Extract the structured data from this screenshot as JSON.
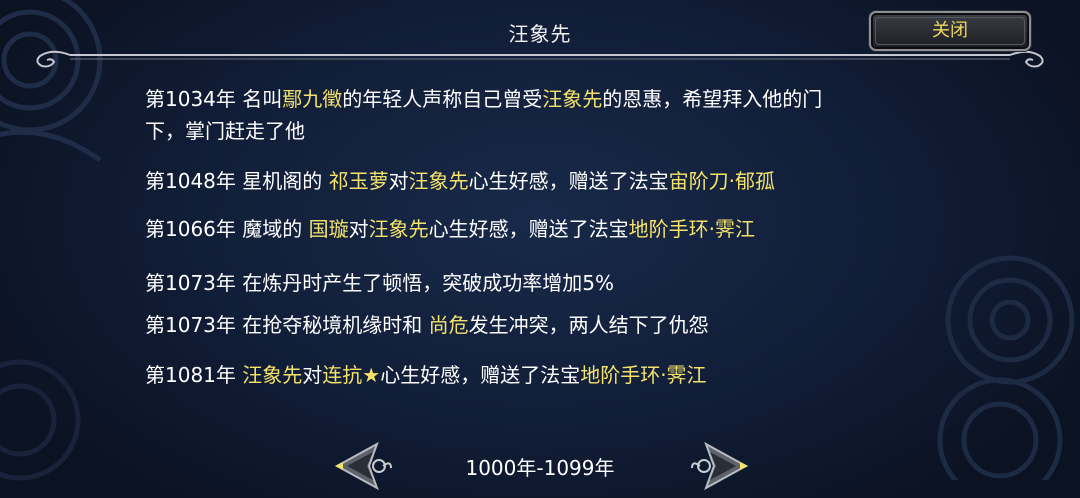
{
  "header": {
    "title": "汪象先",
    "close_label": "关闭"
  },
  "events": [
    {
      "year": "第1034年",
      "parts": [
        {
          "t": " 名叫",
          "hl": false
        },
        {
          "t": "鄢九徵",
          "hl": true
        },
        {
          "t": "的年轻人声称自己曾受",
          "hl": false
        },
        {
          "t": "汪象先",
          "hl": true
        },
        {
          "t": "的恩惠，希望拜入他的门",
          "hl": false
        }
      ],
      "continuation": "下，掌门赶走了他"
    },
    {
      "year": "第1048年",
      "parts": [
        {
          "t": " 星机阁的 ",
          "hl": false
        },
        {
          "t": "祁玉萝",
          "hl": true
        },
        {
          "t": "对",
          "hl": false
        },
        {
          "t": "汪象先",
          "hl": true
        },
        {
          "t": "心生好感，赠送了法宝",
          "hl": false
        },
        {
          "t": "宙阶刀·郁孤",
          "hl": true
        }
      ]
    },
    {
      "year": "第1066年",
      "parts": [
        {
          "t": " 魔域的 ",
          "hl": false
        },
        {
          "t": "国璇",
          "hl": true
        },
        {
          "t": "对",
          "hl": false
        },
        {
          "t": "汪象先",
          "hl": true
        },
        {
          "t": "心生好感，赠送了法宝",
          "hl": false
        },
        {
          "t": "地阶手环·霁江",
          "hl": true
        }
      ]
    },
    {
      "year": "第1073年",
      "parts": [
        {
          "t": " 在炼丹时产生了顿悟，突破成功率增加5%",
          "hl": false
        }
      ]
    },
    {
      "year": "第1073年",
      "parts": [
        {
          "t": " 在抢夺秘境机缘时和 ",
          "hl": false
        },
        {
          "t": "尚危",
          "hl": true
        },
        {
          "t": "发生冲突，两人结下了仇怨",
          "hl": false
        }
      ]
    },
    {
      "year": "第1081年",
      "parts": [
        {
          "t": " ",
          "hl": false
        },
        {
          "t": "汪象先",
          "hl": true
        },
        {
          "t": "对",
          "hl": false
        },
        {
          "t": "连抗★",
          "hl": true
        },
        {
          "t": "心生好感，赠送了法宝",
          "hl": false
        },
        {
          "t": "地阶手环·霁江",
          "hl": true
        }
      ]
    }
  ],
  "pager": {
    "range_label": "1000年-1099年",
    "prev_icon": "ornate-left-arrow-icon",
    "next_icon": "ornate-right-arrow-icon"
  },
  "colors": {
    "highlight": "#f5e26b",
    "text": "#ffffff",
    "background": "#0d1528"
  }
}
